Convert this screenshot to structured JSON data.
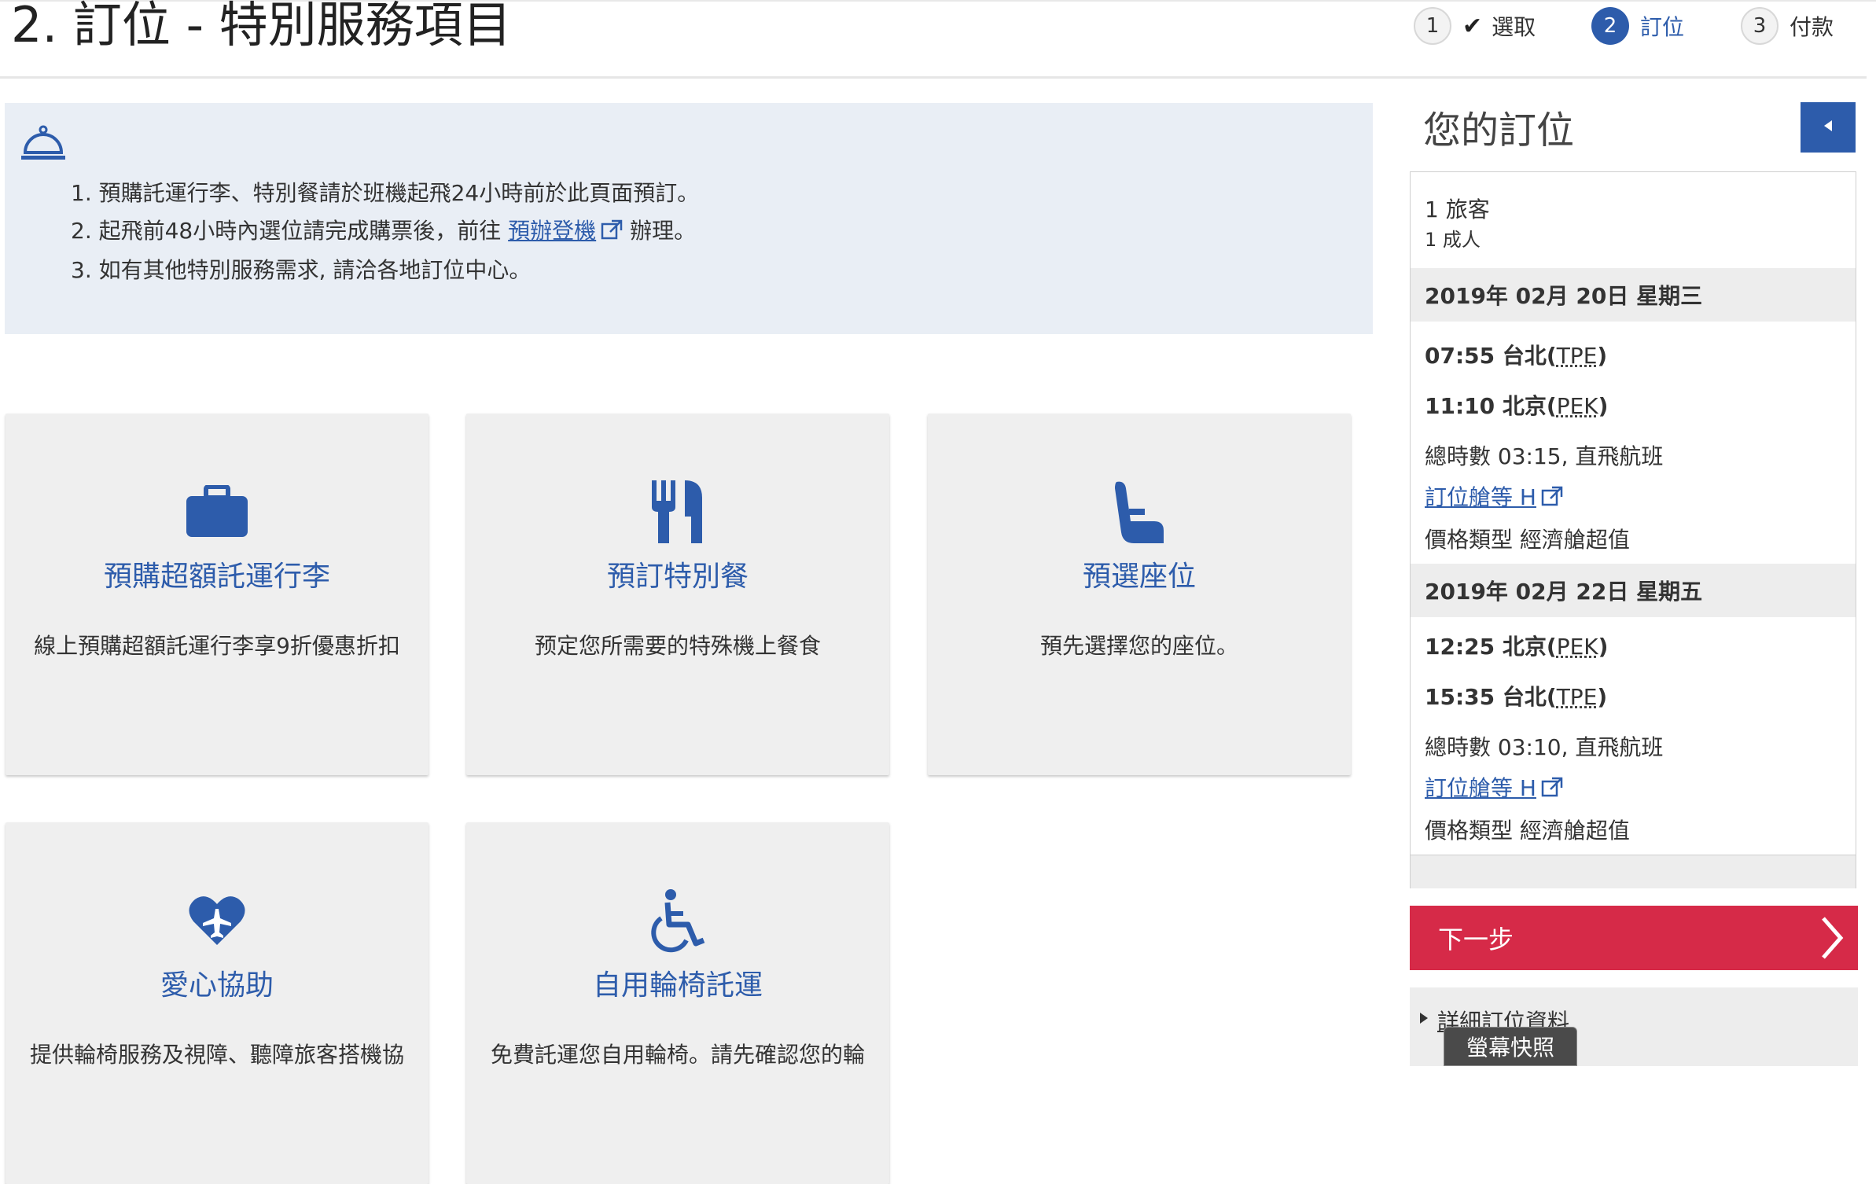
{
  "page": {
    "title": "2. 訂位 - 特別服務項目"
  },
  "steps": [
    {
      "number": "1",
      "label": "選取",
      "state": "done"
    },
    {
      "number": "2",
      "label": "訂位",
      "state": "active"
    },
    {
      "number": "3",
      "label": "付款",
      "state": "todo"
    }
  ],
  "notice": {
    "icon": "service-bell-icon",
    "items": [
      {
        "text": "1. 預購託運行李、特別餐請於班機起飛24小時前於此頁面預訂。"
      },
      {
        "before": "2. 起飛前48小時內選位請完成購票後，前往 ",
        "link": "預辦登機",
        "after": " 辦理。"
      },
      {
        "text": "3. 如有其他特別服務需求, 請洽各地訂位中心。"
      }
    ]
  },
  "services": [
    {
      "icon": "suitcase-icon",
      "title": "預購超額託運行李",
      "desc": "線上預購超額託運行李享9折優惠折扣"
    },
    {
      "icon": "cutlery-icon",
      "title": "預訂特別餐",
      "desc": "预定您所需要的特殊機上餐食"
    },
    {
      "icon": "seat-icon",
      "title": "預選座位",
      "desc": "預先選擇您的座位。"
    },
    {
      "icon": "heart-plane-icon",
      "title": "愛心協助",
      "desc": "提供輪椅服務及視障、聽障旅客搭機協"
    },
    {
      "icon": "wheelchair-icon",
      "title": "自用輪椅託運",
      "desc": "免費託運您自用輪椅。請先確認您的輪"
    }
  ],
  "sidebar": {
    "title": "您的訂位",
    "passengers": {
      "count": "1 旅客",
      "detail": "1 成人"
    },
    "flights": [
      {
        "date": "2019年 02月 20日 星期三",
        "depart_time": "07:55",
        "depart_city": "台北",
        "depart_code": "TPE",
        "arrive_time": "11:10",
        "arrive_city": "北京",
        "arrive_code": "PEK",
        "duration": "總時數 03:15, 直飛航班",
        "fare_class": "訂位艙等 H",
        "fare_type": "價格類型 經濟艙超值"
      },
      {
        "date": "2019年 02月 22日 星期五",
        "depart_time": "12:25",
        "depart_city": "北京",
        "depart_code": "PEK",
        "arrive_time": "15:35",
        "arrive_city": "台北",
        "arrive_code": "TPE",
        "duration": "總時數 03:10, 直飛航班",
        "fare_class": "訂位艙等 H",
        "fare_type": "價格類型 經濟艙超值"
      }
    ],
    "next_label": "下一步",
    "details_label": "詳細訂位資料",
    "screenshot_tip": "螢幕快照"
  },
  "colors": {
    "brand_blue": "#2d5cab",
    "next_red": "#d62a48",
    "notice_bg": "#e9eef5"
  }
}
